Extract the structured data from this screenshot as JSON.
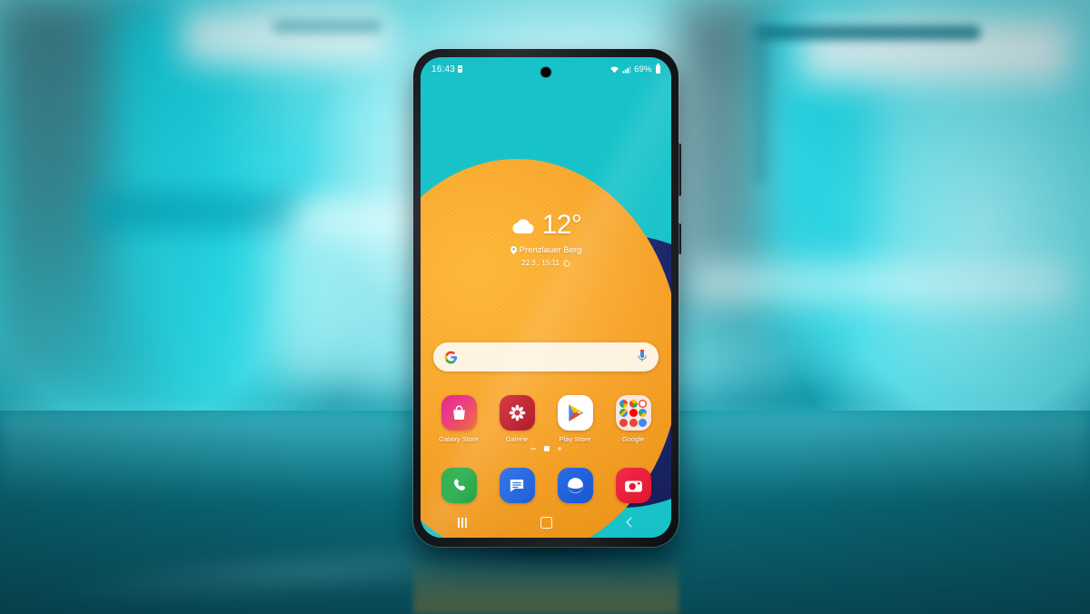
{
  "scene": {
    "description": "Samsung Galaxy smartphone standing on a dark teal table in front of a blurred cyan studio background",
    "background_colors": {
      "cyan_light": "#b7f2f8",
      "cyan_mid": "#3fd8e0",
      "teal_table": "#0a5c6a",
      "teal_dark": "#094e5b"
    }
  },
  "phone": {
    "frame_color": "#17181b",
    "side_buttons": [
      {
        "name": "volume-rocker"
      },
      {
        "name": "power-button"
      }
    ]
  },
  "wallpaper": {
    "cyan": "#17c3c9",
    "orange": "#f5a51f",
    "navy": "#1b2566"
  },
  "status_bar": {
    "clock": "16:43",
    "sim_icon": "sim-card-icon",
    "wifi_icon": "wifi-icon",
    "signal_icon": "cellular-signal-icon",
    "battery_percent": "69%",
    "battery_icon": "battery-icon"
  },
  "weather_widget": {
    "condition_icon": "cloud-icon",
    "temperature": "12°",
    "location_icon": "location-pin-icon",
    "location": "Prenzlauer Berg",
    "updated": "22.3., 15:11",
    "refresh_icon": "refresh-icon"
  },
  "search_bar": {
    "google_icon": "google-g-icon",
    "mic_icon": "microphone-icon",
    "placeholder": ""
  },
  "app_row": [
    {
      "label": "Galaxy Store",
      "icon": "galaxy-store-icon",
      "color": "#e8297f"
    },
    {
      "label": "Galerie",
      "icon": "gallery-icon",
      "color": "#cf2230"
    },
    {
      "label": "Play Store",
      "icon": "play-store-icon",
      "color": "#ffffff"
    },
    {
      "label": "Google",
      "icon": "google-folder-icon",
      "color": "#f4eef0"
    }
  ],
  "google_folder_apps": [
    {
      "name": "google-search-icon",
      "color": "#ffffff"
    },
    {
      "name": "chrome-icon",
      "color": "#ffffff"
    },
    {
      "name": "gmail-icon",
      "color": "#ffffff"
    },
    {
      "name": "maps-icon",
      "color": "#ffffff"
    },
    {
      "name": "youtube-icon",
      "color": "#ff0000"
    },
    {
      "name": "drive-icon",
      "color": "#ffffff"
    },
    {
      "name": "photos-icon",
      "color": "#ea4335"
    },
    {
      "name": "play-movies-icon",
      "color": "#ea4335"
    },
    {
      "name": "duo-icon",
      "color": "#4285f4"
    }
  ],
  "page_indicator": {
    "dots": [
      "bar",
      "home",
      "dot"
    ],
    "active_index": 1
  },
  "dock": [
    {
      "label": "Phone",
      "icon": "phone-icon",
      "color": "#1ba23d"
    },
    {
      "label": "Messages",
      "icon": "messages-icon",
      "color": "#2f72e8"
    },
    {
      "label": "Samsung Internet",
      "icon": "internet-browser-icon",
      "color": "#2060d8"
    },
    {
      "label": "Camera",
      "icon": "camera-icon",
      "color": "#e6172f"
    }
  ],
  "nav_bar": [
    {
      "label": "Recents",
      "icon": "recents-icon"
    },
    {
      "label": "Home",
      "icon": "home-icon"
    },
    {
      "label": "Back",
      "icon": "back-icon"
    }
  ]
}
